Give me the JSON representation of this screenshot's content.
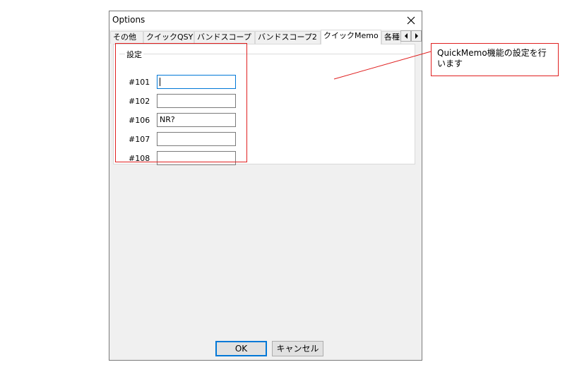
{
  "window": {
    "title": "Options"
  },
  "tabs": [
    {
      "label": "その他"
    },
    {
      "label": "クイックQSY"
    },
    {
      "label": "バンドスコープ"
    },
    {
      "label": "バンドスコープ2"
    },
    {
      "label": "クイックMemo"
    },
    {
      "label": "各種"
    }
  ],
  "panel": {
    "group_title": "設定",
    "fields": [
      {
        "label": "#101",
        "value": ""
      },
      {
        "label": "#102",
        "value": ""
      },
      {
        "label": "#106",
        "value": "NR?"
      },
      {
        "label": "#107",
        "value": ""
      },
      {
        "label": "#108",
        "value": ""
      }
    ]
  },
  "buttons": {
    "ok": "OK",
    "cancel": "キャンセル"
  },
  "annotation": {
    "text": "QuickMemo機能の設定を行います",
    "color": "#e02020"
  },
  "icons": {
    "close": "close-icon",
    "tab_left": "arrow-left-icon",
    "tab_right": "arrow-right-icon"
  }
}
